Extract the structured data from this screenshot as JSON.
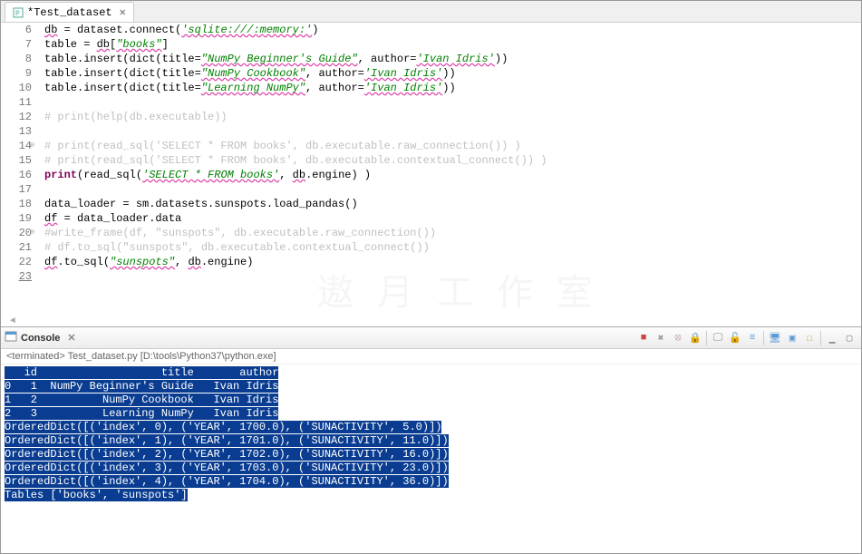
{
  "editor": {
    "tab_label": "*Test_dataset",
    "lines": [
      {
        "n": "6",
        "html": "<span class='tk-def spell'>db</span> = dataset.connect(<span class='tk-strg'>'sqlite:///:memory:'</span>)"
      },
      {
        "n": "7",
        "html": "table = <span class='tk-def spell'>db</span>[<span class='tk-strg'>\"books\"</span>]"
      },
      {
        "n": "8",
        "html": "table.insert(dict(title=<span class='tk-strg'>\"NumPy Beginner's Guide\"</span>, author=<span class='tk-strg'>'Ivan Idris'</span>))"
      },
      {
        "n": "9",
        "html": "table.insert(dict(title=<span class='tk-strg'>\"NumPy Cookbook\"</span>, author=<span class='tk-strg'>'Ivan Idris'</span>))"
      },
      {
        "n": "10",
        "html": "table.insert(dict(title=<span class='tk-strg'>\"Learning NumPy\"</span>, author=<span class='tk-strg'>'Ivan Idris'</span>))"
      },
      {
        "n": "11",
        "html": ""
      },
      {
        "n": "12",
        "html": "<span class='tk-cm'># print(help(db.executable))</span>"
      },
      {
        "n": "13",
        "html": ""
      },
      {
        "n": "14",
        "fold": true,
        "html": "<span class='tk-cm'># print(read_sql('SELECT * FROM books', db.executable.raw_connection()) )</span>"
      },
      {
        "n": "15",
        "html": "<span class='tk-cm'># print(read_sql('SELECT * FROM books', db.executable.contextual_connect()) )</span>"
      },
      {
        "n": "16",
        "html": "<span class='tk-kw'>print</span>(read_sql(<span class='tk-strg'>'SELECT * FROM books'</span>, <span class='tk-def spell'>db</span>.engine) )"
      },
      {
        "n": "17",
        "html": ""
      },
      {
        "n": "18",
        "html": "data_loader = sm.datasets.sunspots.load_pandas()"
      },
      {
        "n": "19",
        "html": "<span class='tk-def spell'>df</span> = data_loader.data"
      },
      {
        "n": "20",
        "fold": true,
        "html": "<span class='tk-cm'>#write_frame(df, \"sunspots\", db.executable.raw_connection())</span>"
      },
      {
        "n": "21",
        "html": "<span class='tk-cm'># df.to_sql(\"sunspots\", db.executable.contextual_connect())</span>"
      },
      {
        "n": "22",
        "html": "<span class='tk-def spell'>df</span>.to_sql(<span class='tk-strg'>\"sunspots\"</span>, <span class='tk-def spell'>db</span>.engine)"
      },
      {
        "n": "23",
        "underline": true,
        "html": ""
      }
    ]
  },
  "console": {
    "title": "Console",
    "termination": "<terminated> Test_dataset.py [D:\\tools\\Python37\\python.exe]",
    "output": [
      "   id                   title       author",
      "0   1  NumPy Beginner's Guide   Ivan Idris",
      "1   2          NumPy Cookbook   Ivan Idris",
      "2   3          Learning NumPy   Ivan Idris",
      "OrderedDict([('index', 0), ('YEAR', 1700.0), ('SUNACTIVITY', 5.0)])",
      "OrderedDict([('index', 1), ('YEAR', 1701.0), ('SUNACTIVITY', 11.0)])",
      "OrderedDict([('index', 2), ('YEAR', 1702.0), ('SUNACTIVITY', 16.0)])",
      "OrderedDict([('index', 3), ('YEAR', 1703.0), ('SUNACTIVITY', 23.0)])",
      "OrderedDict([('index', 4), ('YEAR', 1704.0), ('SUNACTIVITY', 36.0)])",
      "Tables ['books', 'sunspots']"
    ],
    "toolbar_icons": [
      "stop-icon",
      "remove-icon",
      "remove-all-icon",
      "pin-icon",
      "display-icon",
      "scroll-lock-icon",
      "word-wrap-icon",
      "show-console-icon",
      "open-console-icon",
      "new-console-icon",
      "min-icon",
      "max-icon"
    ]
  }
}
